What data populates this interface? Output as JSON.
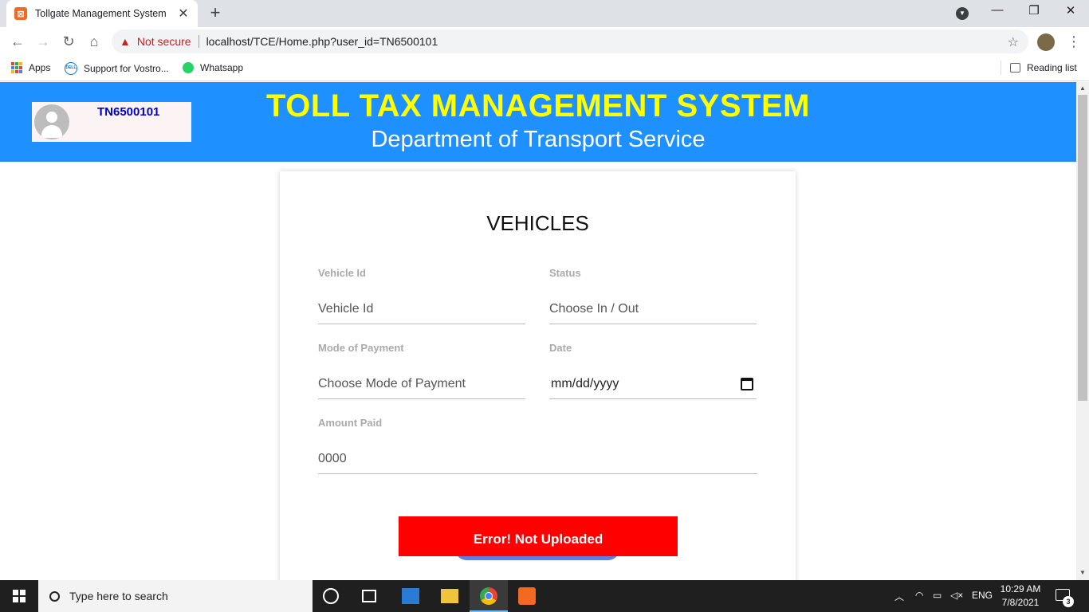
{
  "browser": {
    "tab_title": "Tollgate Management System",
    "tab_close": "✕",
    "new_tab": "+",
    "security_label": "Not secure",
    "url": "localhost/TCE/Home.php?user_id=TN6500101",
    "bookmarks": [
      {
        "label": "Apps"
      },
      {
        "label": "Support for Vostro..."
      },
      {
        "label": "Whatsapp"
      }
    ],
    "reading_list": "Reading list"
  },
  "banner": {
    "user_id": "TN6500101",
    "title": "TOLL TAX MANAGEMENT SYSTEM",
    "subtitle": "Department of Transport Service",
    "color": "#1e90ff",
    "title_color": "#ffff00"
  },
  "form": {
    "heading": "VEHICLES",
    "fields": {
      "vehicle_id": {
        "label": "Vehicle Id",
        "placeholder": "Vehicle Id"
      },
      "status": {
        "label": "Status",
        "placeholder": "Choose In / Out"
      },
      "payment": {
        "label": "Mode of Payment",
        "placeholder": "Choose Mode of Payment"
      },
      "date": {
        "label": "Date",
        "value": "mm/dd/yyyy"
      },
      "amount": {
        "label": "Amount Paid",
        "placeholder": "0000"
      }
    },
    "error_message": "Error! Not Uploaded",
    "error_color": "#ff0000"
  },
  "taskbar": {
    "search_placeholder": "Type here to search",
    "language": "ENG",
    "time": "10:29 AM",
    "date": "7/8/2021",
    "notification_count": "3"
  }
}
